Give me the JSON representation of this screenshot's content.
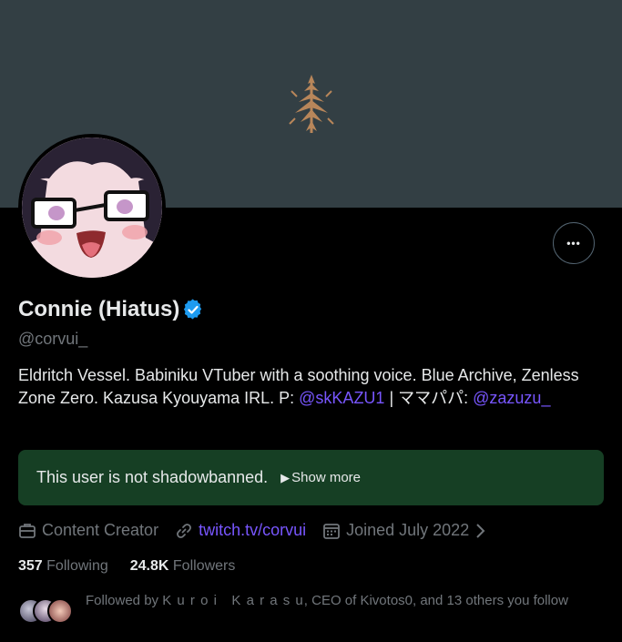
{
  "profile": {
    "display_name": "Connie (Hiatus)",
    "handle": "@corvui_",
    "bio_part1": "Eldritch Vessel. Babiniku VTuber with a soothing voice. Blue Archive, Zenless Zone Zero. Kazusa Kyouyama IRL. P: ",
    "bio_link1": "@skKAZU1",
    "bio_part2": " | ママパパ: ",
    "bio_link2": "@zazuzu_"
  },
  "actions": {
    "more_icon": "more-horizontal-icon",
    "more_label": "•••"
  },
  "shadowban": {
    "text": "This user is not shadowbanned.",
    "show_more_label": "Show more",
    "show_more_icon": "▶"
  },
  "meta": {
    "category": "Content Creator",
    "website": "twitch.tv/corvui",
    "joined": "Joined July 2022"
  },
  "stats": {
    "following_count": "357",
    "following_label": "Following",
    "followers_count": "24.8K",
    "followers_label": "Followers"
  },
  "followed_by": {
    "prefix": "Followed by ",
    "names": "K u r o i   K a r a s u",
    "suffix": ", CEO of Kivotos0, and 13 others you follow"
  },
  "colors": {
    "banner": "#333f44",
    "accent_link": "#7856ff",
    "verified": "#1d9bf0",
    "shadowban_bg": "#163f24"
  }
}
